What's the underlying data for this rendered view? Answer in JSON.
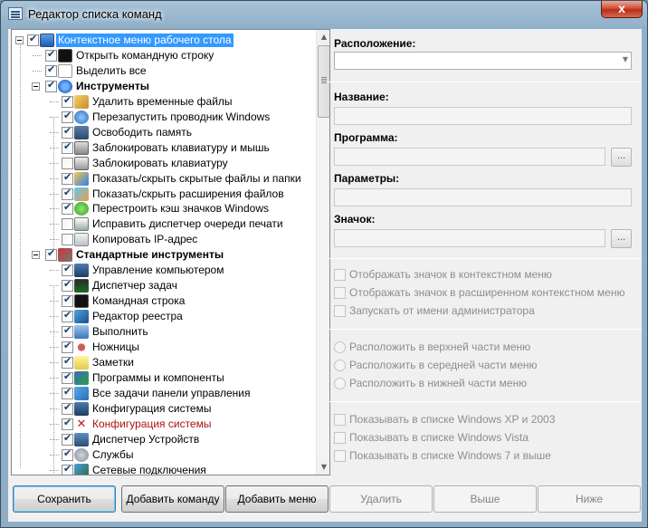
{
  "window": {
    "title": "Редактор списка команд",
    "close_label": "x"
  },
  "tree": {
    "items": [
      {
        "label": "Контекстное меню рабочего стола",
        "level": 0,
        "checked": true,
        "expander": true,
        "selected": true,
        "icon": "desktop-icon"
      },
      {
        "label": "Открыть командную строку",
        "level": 1,
        "checked": true,
        "icon": "console-icon"
      },
      {
        "label": "Выделить все",
        "level": 1,
        "checked": true,
        "icon": "page-icon"
      },
      {
        "label": "Инструменты",
        "level": 1,
        "checked": true,
        "expander": true,
        "bold": true,
        "icon": "arrow-icon"
      },
      {
        "label": "Удалить временные файлы",
        "level": 2,
        "checked": true,
        "icon": "broom-icon"
      },
      {
        "label": "Перезапустить проводник Windows",
        "level": 2,
        "checked": true,
        "icon": "explorer-icon"
      },
      {
        "label": "Освободить память",
        "level": 2,
        "checked": true,
        "icon": "memory-icon"
      },
      {
        "label": "Заблокировать клавиатуру и мышь",
        "level": 2,
        "checked": true,
        "icon": "keyboard-mouse-icon"
      },
      {
        "label": "Заблокировать клавиатуру",
        "level": 2,
        "checked": false,
        "icon": "keyboard-icon"
      },
      {
        "label": "Показать/скрыть скрытые файлы и папки",
        "level": 2,
        "checked": true,
        "icon": "hidden-files-icon"
      },
      {
        "label": "Показать/скрыть расширения файлов",
        "level": 2,
        "checked": true,
        "icon": "extensions-icon"
      },
      {
        "label": "Перестроить кэш значков Windows",
        "level": 2,
        "checked": true,
        "icon": "refresh-icon"
      },
      {
        "label": "Исправить диспетчер очереди печати",
        "level": 2,
        "checked": false,
        "icon": "printer-icon"
      },
      {
        "label": "Копировать IP-адрес",
        "level": 2,
        "checked": false,
        "icon": "network-icon"
      },
      {
        "label": "Стандартные инструменты",
        "level": 1,
        "checked": true,
        "expander": true,
        "bold": true,
        "icon": "tools-icon"
      },
      {
        "label": "Управление компьютером",
        "level": 2,
        "checked": true,
        "icon": "computer-management-icon"
      },
      {
        "label": "Диспетчер задач",
        "level": 2,
        "checked": true,
        "icon": "task-manager-icon"
      },
      {
        "label": "Командная строка",
        "level": 2,
        "checked": true,
        "icon": "console-icon"
      },
      {
        "label": "Редактор реестра",
        "level": 2,
        "checked": true,
        "icon": "registry-icon"
      },
      {
        "label": "Выполнить",
        "level": 2,
        "checked": true,
        "icon": "run-icon"
      },
      {
        "label": "Ножницы",
        "level": 2,
        "checked": true,
        "icon": "scissors-icon"
      },
      {
        "label": "Заметки",
        "level": 2,
        "checked": true,
        "icon": "notes-icon"
      },
      {
        "label": "Программы и компоненты",
        "level": 2,
        "checked": true,
        "icon": "programs-icon"
      },
      {
        "label": "Все задачи панели управления",
        "level": 2,
        "checked": true,
        "icon": "control-panel-icon"
      },
      {
        "label": "Конфигурация системы",
        "level": 2,
        "checked": true,
        "icon": "msconfig-icon"
      },
      {
        "label": "Конфигурация системы",
        "level": 2,
        "checked": true,
        "red": true,
        "icon": "error-x-icon"
      },
      {
        "label": "Диспетчер Устройств",
        "level": 2,
        "checked": true,
        "icon": "device-manager-icon"
      },
      {
        "label": "Службы",
        "level": 2,
        "checked": true,
        "icon": "services-icon"
      },
      {
        "label": "Сетевые подключения",
        "level": 2,
        "checked": true,
        "icon": "network-connections-icon"
      }
    ]
  },
  "props": {
    "location_label": "Расположение:",
    "location_value": "",
    "name_label": "Название:",
    "program_label": "Программа:",
    "params_label": "Параметры:",
    "icon_label": "Значок:",
    "browse_label": "...",
    "checkboxes": [
      "Отображать значок в контекстном меню",
      "Отображать значок в расширенном контекстном меню",
      "Запускать от имени администратора"
    ],
    "radios": [
      "Расположить в верхней части меню",
      "Расположить в середней части меню",
      "Расположить в нижней части меню"
    ],
    "os_checkboxes": [
      "Показывать в списке Windows XP и 2003",
      "Показывать в списке Windows Vista",
      "Показывать в списке Windows 7 и выше"
    ]
  },
  "buttons": {
    "save": "Сохранить",
    "add_command": "Добавить команду",
    "add_menu": "Добавить меню",
    "delete": "Удалить",
    "up": "Выше",
    "down": "Ниже"
  },
  "colors": {
    "selection": "#3399ff",
    "error_text": "#b01010",
    "titlebar": "#a9c3d8"
  }
}
